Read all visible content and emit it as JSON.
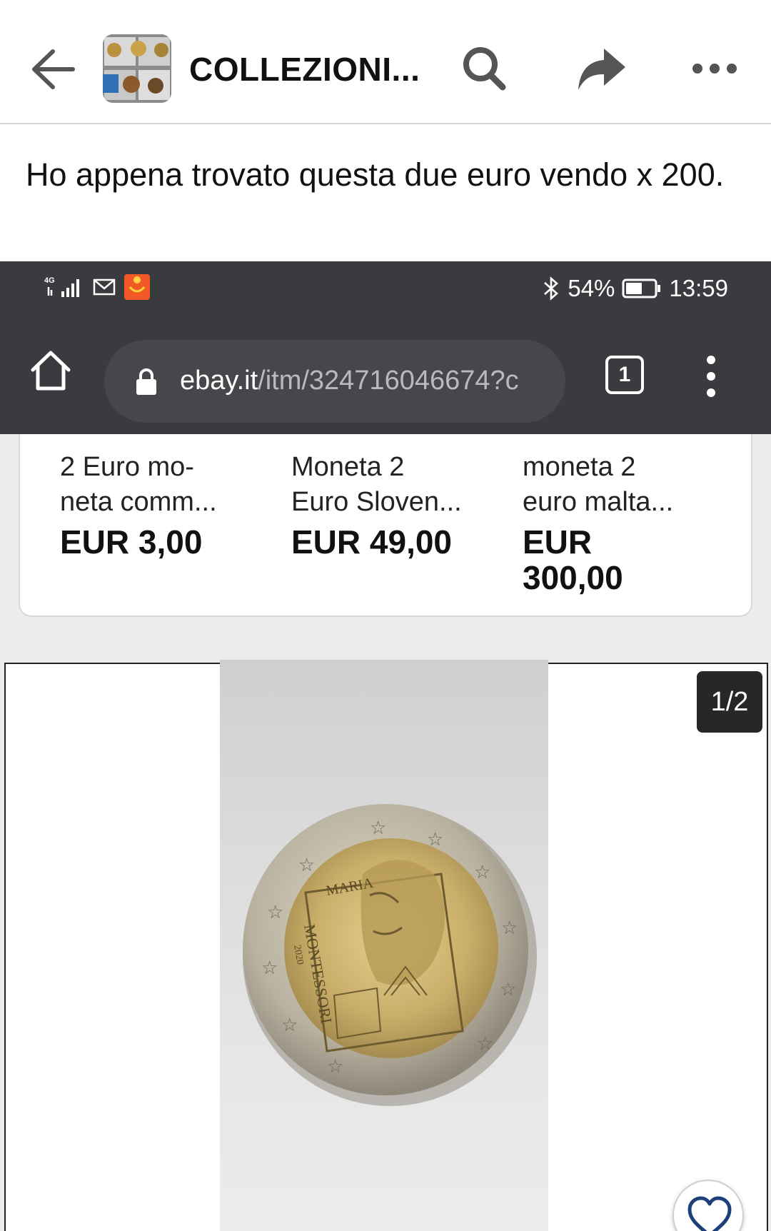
{
  "fb_header": {
    "group_name": "COLLEZIONI...",
    "icons": [
      "back-arrow-icon",
      "search-icon",
      "share-icon",
      "more-icon"
    ]
  },
  "post": {
    "text": "Ho appena trovato questa due euro vendo x 200."
  },
  "screenshot": {
    "status_bar": {
      "network": "4G",
      "battery": "54%",
      "time": "13:59",
      "icons": [
        "signal-icon",
        "gmail-icon",
        "app-notification-icon",
        "bluetooth-icon",
        "battery-icon"
      ]
    },
    "browser": {
      "url_domain": "ebay.it",
      "url_path": "/itm/324716046674?c",
      "tab_count": "1",
      "icons": [
        "home-icon",
        "lock-icon",
        "tabs-icon",
        "overflow-menu-icon"
      ]
    },
    "related_items": [
      {
        "title": "2 Euro mo-neta comm...",
        "title_line1": "2 Euro mo-",
        "title_line2": "neta comm...",
        "price": "EUR 3,00"
      },
      {
        "title": "Moneta 2 Euro Sloven...",
        "title_line1": "Moneta 2",
        "title_line2": "Euro Sloven...",
        "price": "EUR 49,00"
      },
      {
        "title": "moneta 2 euro malta...",
        "title_line1": "moneta 2",
        "title_line2": "euro malta...",
        "price_line1": "EUR",
        "price_line2": "300,00"
      }
    ],
    "gallery": {
      "counter": "1/2",
      "coin_inscription_1": "MARIA",
      "coin_inscription_2": "MONTESSORI",
      "coin_year": "2020",
      "coin_colors": {
        "outer_ring": "#b9b2a0",
        "center": "#c9ae6a"
      }
    },
    "colors": {
      "browser_bar": "#3a3b3f",
      "omnibox": "#46474b",
      "favorite_heart": "#1f3f7a"
    }
  }
}
